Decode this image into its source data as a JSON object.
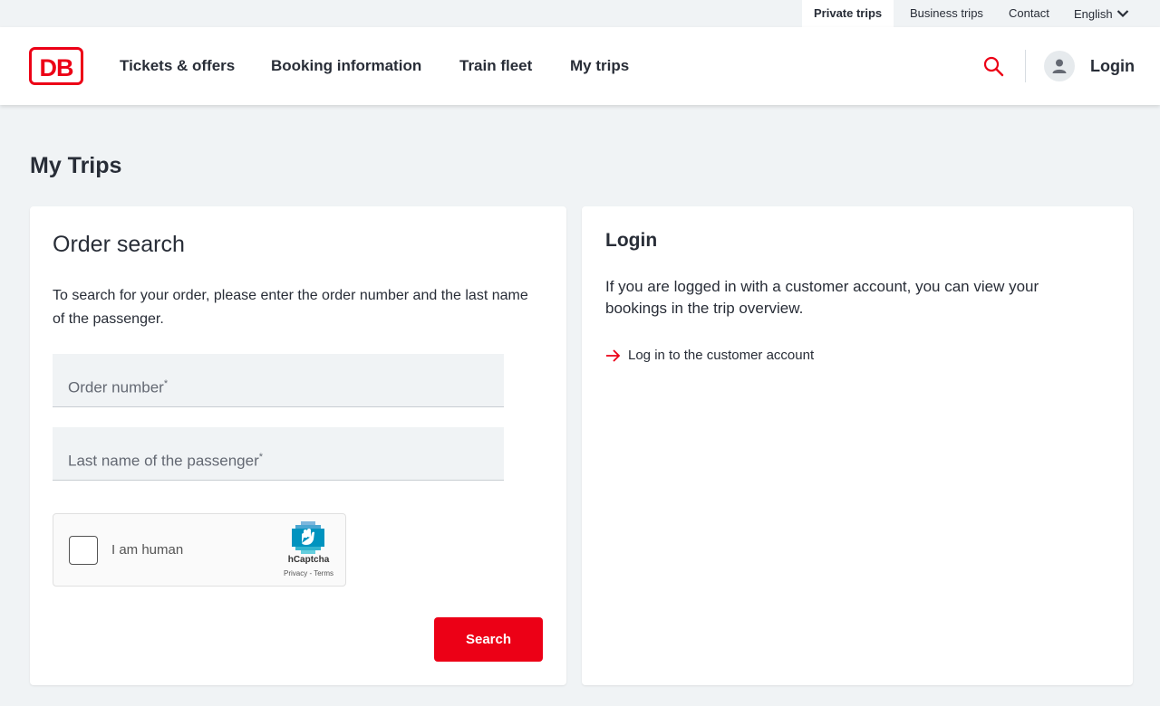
{
  "topbar": {
    "items": [
      "Private trips",
      "Business trips",
      "Contact"
    ],
    "language": "English"
  },
  "header": {
    "logo": "DB",
    "nav": [
      "Tickets & offers",
      "Booking information",
      "Train fleet",
      "My trips"
    ],
    "login_label": "Login"
  },
  "page": {
    "title": "My Trips"
  },
  "order_search": {
    "title": "Order search",
    "intro": "To search for your order, please enter the order number and the last name of the passenger.",
    "order_number_label": "Order number",
    "last_name_label": "Last name of the passenger",
    "required_mark": "*",
    "captcha": {
      "label": "I am human",
      "brand": "hCaptcha",
      "links": "Privacy - Terms"
    },
    "search_label": "Search"
  },
  "login_panel": {
    "title": "Login",
    "text": "If you are logged in with a customer account, you can view your bookings in the trip overview.",
    "link_label": "Log in to the customer account"
  },
  "colors": {
    "brand_red": "#ec0016",
    "page_bg": "#f0f3f5",
    "text": "#282d37"
  },
  "icons": [
    "search-icon",
    "user-icon",
    "chevron-down-icon",
    "arrow-right-icon",
    "hcaptcha-logo-icon"
  ]
}
